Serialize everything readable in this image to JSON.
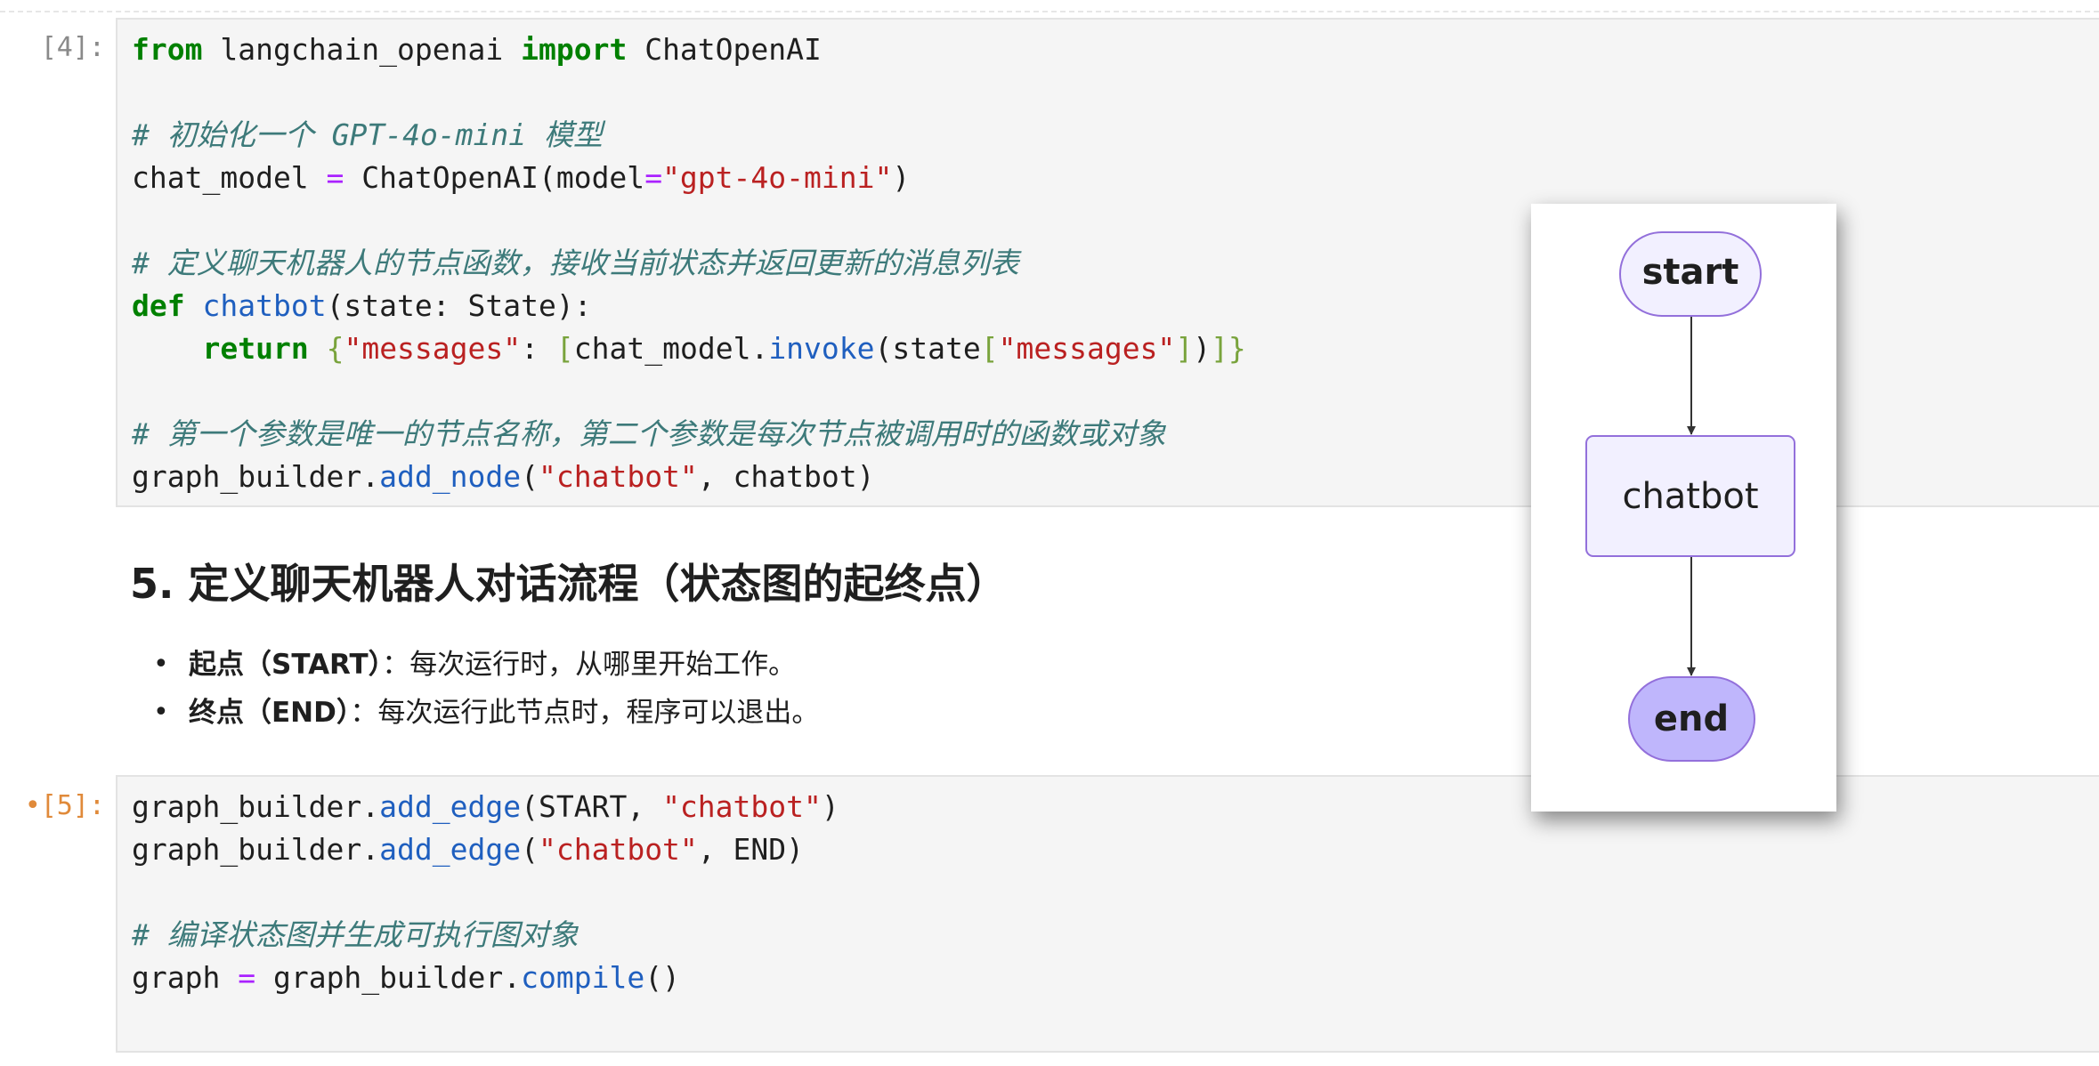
{
  "cell4": {
    "prompt": "[4]:",
    "lines": [
      [
        [
          "kw",
          "from"
        ],
        [
          "pn",
          " langchain_openai "
        ],
        [
          "kw",
          "import"
        ],
        [
          "pn",
          " ChatOpenAI"
        ]
      ],
      [],
      [
        [
          "cm",
          "# 初始化一个 GPT-4o-mini 模型"
        ]
      ],
      [
        [
          "pn",
          "chat_model "
        ],
        [
          "op",
          "="
        ],
        [
          "pn",
          " ChatOpenAI(model"
        ],
        [
          "op",
          "="
        ],
        [
          "str",
          "\"gpt-4o-mini\""
        ],
        [
          "pn",
          ")"
        ]
      ],
      [],
      [
        [
          "cm",
          "# 定义聊天机器人的节点函数，接收当前状态并返回更新的消息列表"
        ]
      ],
      [
        [
          "kw",
          "def"
        ],
        [
          "pn",
          " "
        ],
        [
          "fn",
          "chatbot"
        ],
        [
          "pn",
          "(state: State):"
        ]
      ],
      [
        [
          "pn",
          "    "
        ],
        [
          "kw",
          "return"
        ],
        [
          "pn",
          " "
        ],
        [
          "br",
          "{"
        ],
        [
          "str",
          "\"messages\""
        ],
        [
          "pn",
          ": "
        ],
        [
          "br",
          "["
        ],
        [
          "pn",
          "chat_model."
        ],
        [
          "fn",
          "invoke"
        ],
        [
          "pn",
          "(state"
        ],
        [
          "br",
          "["
        ],
        [
          "str",
          "\"messages\""
        ],
        [
          "br",
          "]"
        ],
        [
          "pn",
          ")"
        ],
        [
          "br",
          "]}"
        ]
      ],
      [],
      [
        [
          "cm",
          "# 第一个参数是唯一的节点名称，第二个参数是每次节点被调用时的函数或对象"
        ]
      ],
      [
        [
          "pn",
          "graph_builder."
        ],
        [
          "fn",
          "add_node"
        ],
        [
          "pn",
          "("
        ],
        [
          "str",
          "\"chatbot\""
        ],
        [
          "pn",
          ", chatbot)"
        ]
      ]
    ]
  },
  "markdown": {
    "title": "5. 定义聊天机器人对话流程（状态图的起终点）",
    "items": [
      {
        "bold": "起点（START）",
        "text": "：每次运行时，从哪里开始工作。"
      },
      {
        "bold": "终点（END）",
        "text": "：每次运行此节点时，程序可以退出。"
      }
    ]
  },
  "cell5": {
    "prompt": "•[5]:",
    "lines": [
      [
        [
          "pn",
          "graph_builder."
        ],
        [
          "fn",
          "add_edge"
        ],
        [
          "pn",
          "(START, "
        ],
        [
          "str",
          "\"chatbot\""
        ],
        [
          "pn",
          ")"
        ]
      ],
      [
        [
          "pn",
          "graph_builder."
        ],
        [
          "fn",
          "add_edge"
        ],
        [
          "pn",
          "("
        ],
        [
          "str",
          "\"chatbot\""
        ],
        [
          "pn",
          ", END)"
        ]
      ],
      [],
      [
        [
          "cm",
          "# 编译状态图并生成可执行图对象"
        ]
      ],
      [
        [
          "pn",
          "graph "
        ],
        [
          "op",
          "="
        ],
        [
          "pn",
          " graph_builder."
        ],
        [
          "fn",
          "compile"
        ],
        [
          "pn",
          "()"
        ]
      ],
      []
    ]
  },
  "graph": {
    "nodes": {
      "start": {
        "label": "start"
      },
      "chatbot": {
        "label": "chatbot"
      },
      "end": {
        "label": "end"
      }
    },
    "edges": [
      [
        "start",
        "chatbot"
      ],
      [
        "chatbot",
        "end"
      ]
    ],
    "colors": {
      "node_fill": "#f2f0ff",
      "node_stroke": "#9370db",
      "end_fill": "#bfb6fc",
      "edge": "#333333"
    }
  }
}
